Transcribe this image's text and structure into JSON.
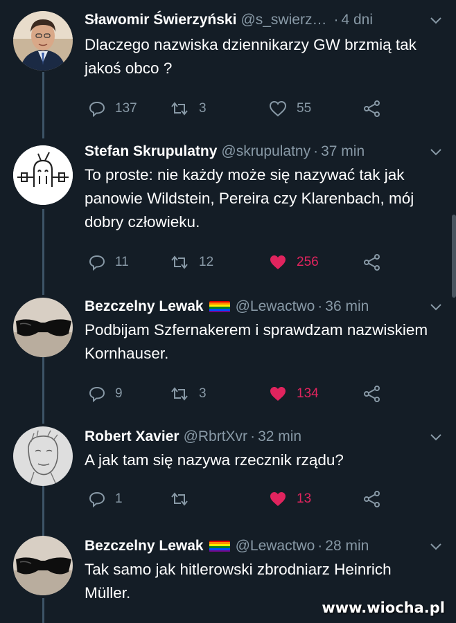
{
  "tweets": [
    {
      "name": "Sławomir Świerzyński",
      "handle": "@s_swierz…",
      "sep": "·",
      "time": "4 dni",
      "text": "Dlaczego nazwiska dziennikarzy GW brzmią tak jakoś obco ?",
      "replies": "137",
      "retweets": "3",
      "likes": "55",
      "liked": false,
      "avatar": "man-portrait"
    },
    {
      "name": "Stefan Skrupulatny",
      "handle": "@skrupulatny",
      "sep": "·",
      "time": "37 min",
      "text": "To proste: nie każdy może się nazywać tak jak panowie Wildstein, Pereira czy Klarenbach, mój dobry człowieku.",
      "replies": "11",
      "retweets": "12",
      "likes": "256",
      "liked": true,
      "avatar": "cartoon-drawing"
    },
    {
      "name": "Bezczelny Lewak",
      "handle": "@Lewactwo",
      "sep": "·",
      "time": "36 min",
      "text": "Podbijam Szfernakerem i sprawdzam nazwiskiem Kornhauser.",
      "replies": "9",
      "retweets": "3",
      "likes": "134",
      "liked": true,
      "avatar": "sunglasses"
    },
    {
      "name": "Robert Xavier",
      "handle": "@RbrtXvr",
      "sep": "·",
      "time": "32 min",
      "text": "A jak tam się nazywa rzecznik rządu?",
      "replies": "1",
      "retweets": "",
      "likes": "13",
      "liked": true,
      "avatar": "sketch-face"
    },
    {
      "name": "Bezczelny Lewak",
      "handle": "@Lewactwo",
      "sep": "·",
      "time": "28 min",
      "text": "Tak samo jak hitlerowski zbrodniarz Heinrich Müller.",
      "avatar": "sunglasses"
    }
  ],
  "colors": {
    "background": "#141d26",
    "muted": "#8899a6",
    "like": "#e0245e",
    "thread": "#3d5466"
  },
  "watermark": "www.wiocha.pl"
}
